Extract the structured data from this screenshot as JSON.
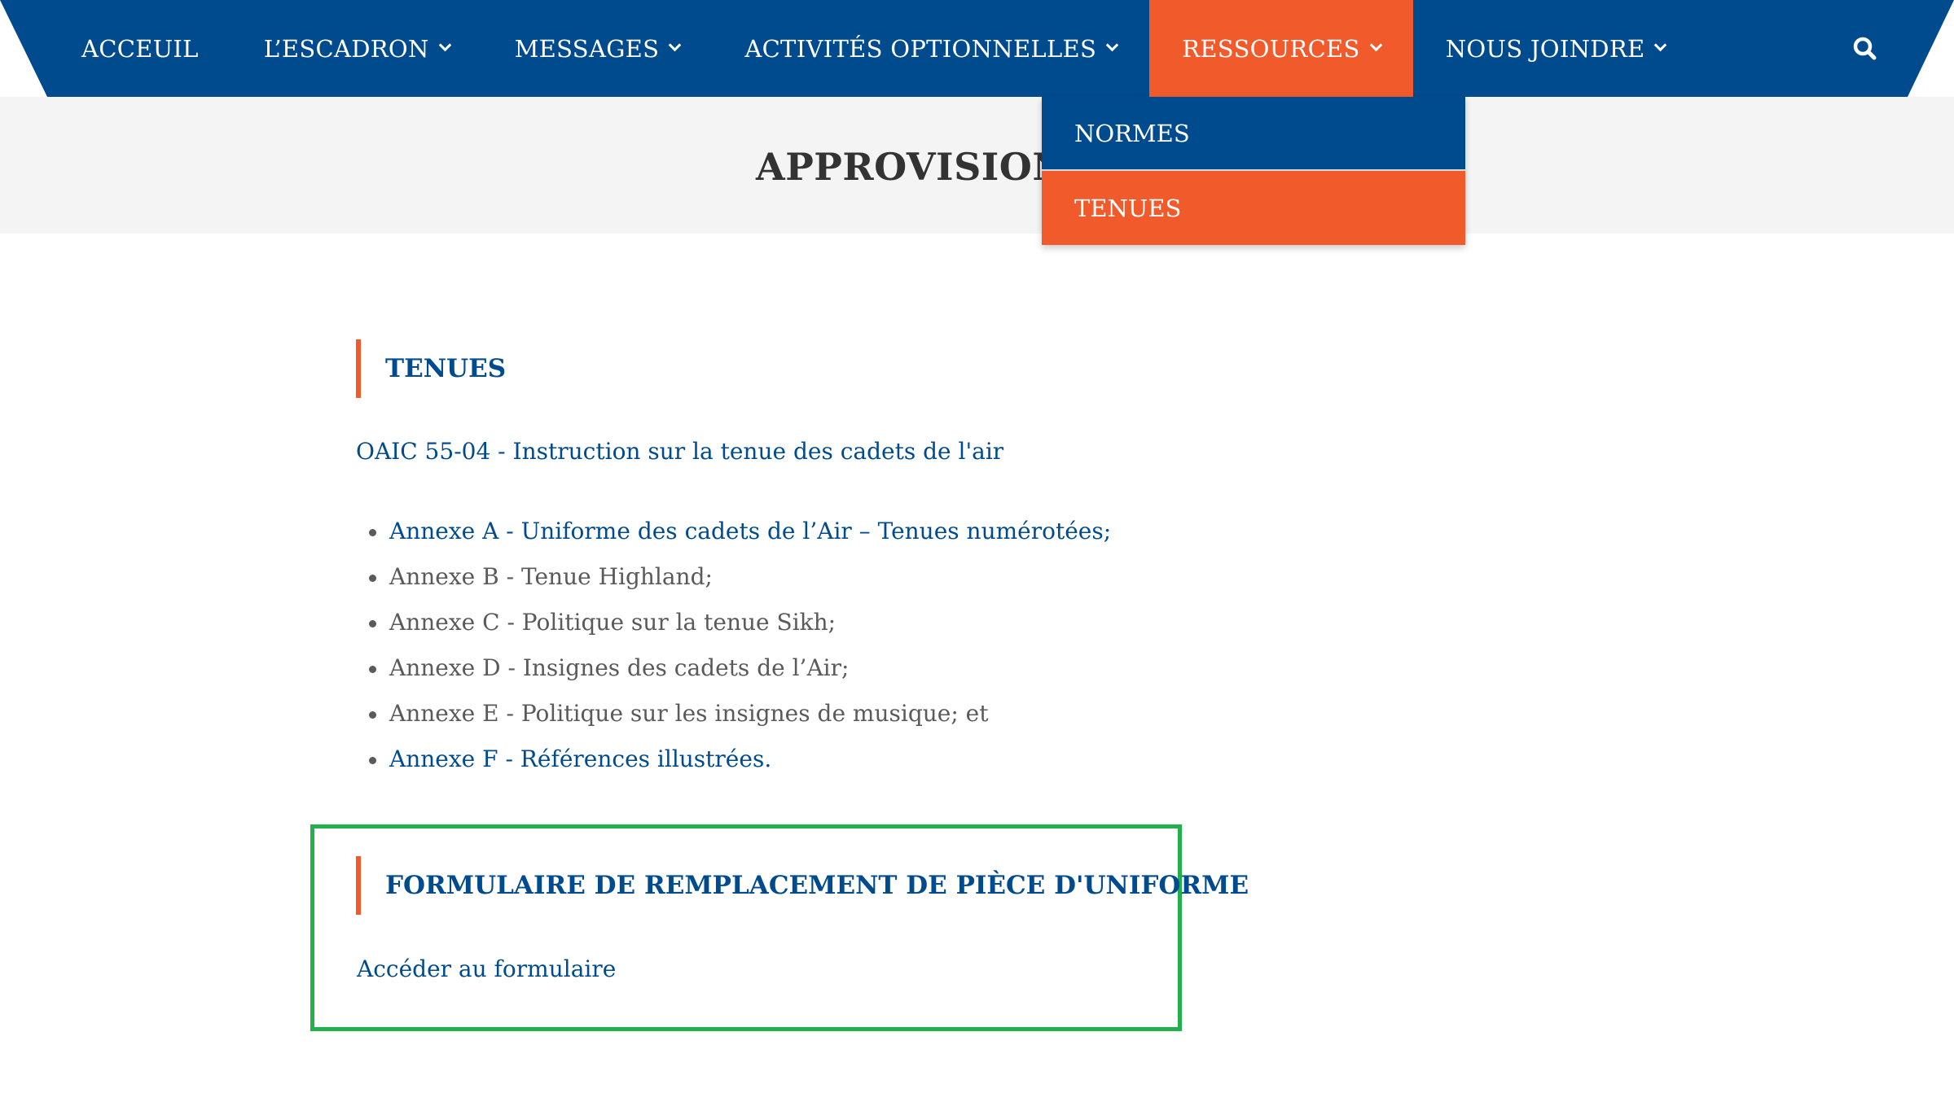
{
  "nav": {
    "items": [
      {
        "label": "ACCEUIL",
        "has_dropdown": false,
        "active": false
      },
      {
        "label": "L’ESCADRON",
        "has_dropdown": true,
        "active": false
      },
      {
        "label": "MESSAGES",
        "has_dropdown": true,
        "active": false
      },
      {
        "label": "ACTIVITÉS OPTIONNELLES",
        "has_dropdown": true,
        "active": false
      },
      {
        "label": "RESSOURCES",
        "has_dropdown": true,
        "active": true
      },
      {
        "label": "NOUS JOINDRE",
        "has_dropdown": true,
        "active": false
      }
    ],
    "search_icon": "search-icon"
  },
  "dropdown": {
    "items": [
      {
        "label": "NORMES"
      },
      {
        "label": "TENUES"
      }
    ]
  },
  "page": {
    "title": "APPROVISIONNEMENT"
  },
  "tenues": {
    "heading": "TENUES",
    "oaic_link": "OAIC 55-04 - Instruction sur la tenue des cadets de l'air",
    "annexes": [
      {
        "label": "Annexe A - Uniforme des cadets de l’Air – Tenues numérotées;",
        "is_link": true
      },
      {
        "label": "Annexe B - Tenue Highland;",
        "is_link": false
      },
      {
        "label": "Annexe C - Politique sur la tenue Sikh;",
        "is_link": false
      },
      {
        "label": "Annexe D - Insignes des cadets de l’Air;",
        "is_link": false
      },
      {
        "label": "Annexe E - Politique sur les insignes de musique; et",
        "is_link": false
      },
      {
        "label": "Annexe F - Références illustrées.",
        "is_link": true
      }
    ]
  },
  "form_section": {
    "heading": "FORMULAIRE DE REMPLACEMENT DE PIÈCE D'UNIFORME",
    "link": "Accéder au formulaire"
  },
  "colors": {
    "primary_blue": "#004b8d",
    "accent_orange": "#f15a2b",
    "highlight_green": "#22b04b",
    "hero_gray": "#f4f4f4"
  }
}
